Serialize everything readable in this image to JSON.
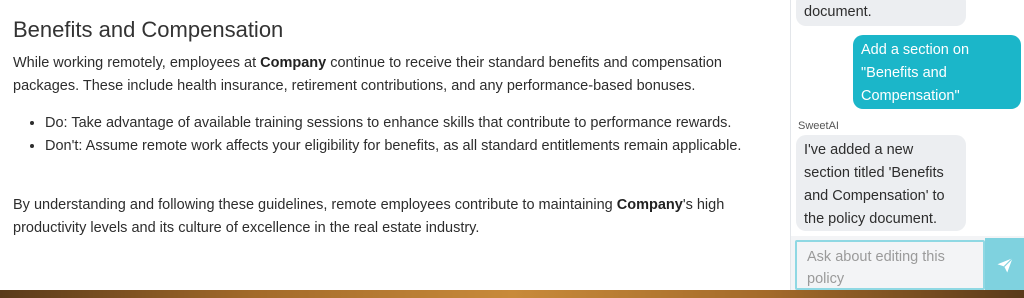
{
  "document": {
    "heading": "Benefits and Compensation",
    "intro": {
      "pre": "While working remotely, employees at ",
      "company": "Company",
      "post": " continue to receive their standard benefits and compensation packages. These include health insurance, retirement contributions, and any performance-based bonuses."
    },
    "bullets": [
      "Do: Take advantage of available training sessions to enhance skills that contribute to performance rewards.",
      "Don't: Assume remote work affects your eligibility for benefits, as all standard entitlements remain applicable."
    ],
    "closing": {
      "pre": "By understanding and following these guidelines, remote employees contribute to maintaining ",
      "company": "Company",
      "post": "'s high productivity levels and its culture of excellence in the real estate industry."
    }
  },
  "chat": {
    "partial_ai_message": "document.",
    "user_message": "Add a section on \"Benefits and Compensation\"",
    "ai_sender": "SweetAI",
    "ai_message": "I've added a new section titled 'Benefits and Compensation' to the policy document.",
    "input_placeholder": "Ask about editing this policy",
    "send_icon": "send-icon"
  },
  "colors": {
    "user_bubble": "#1bb6c9",
    "ai_bubble": "#eceef1",
    "send_button": "#7fd2df"
  }
}
